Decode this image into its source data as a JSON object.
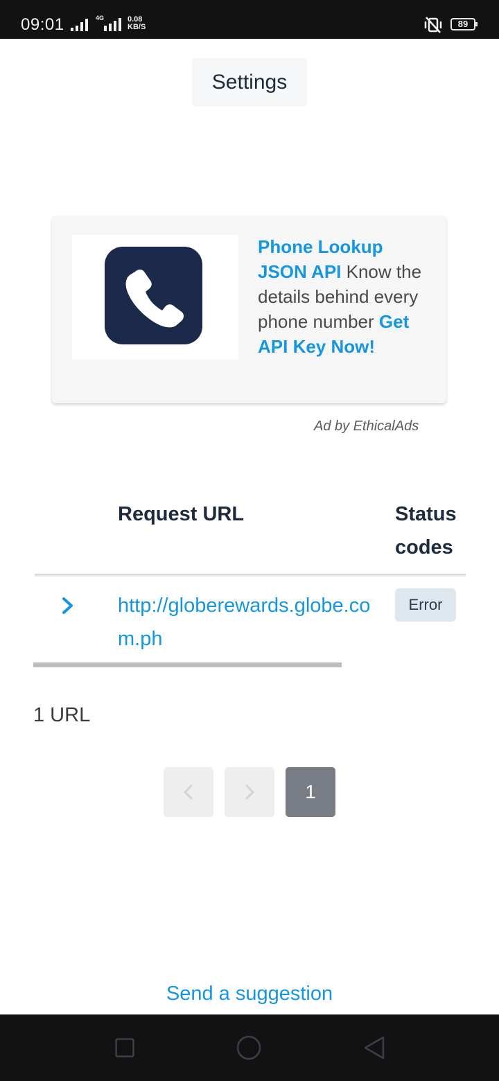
{
  "status_bar": {
    "time": "09:01",
    "network_type": "4G",
    "data_speed_value": "0.08",
    "data_speed_unit": "KB/S",
    "battery": "89",
    "icons": [
      "signal-icon",
      "signal-4g-icon",
      "mute-vibrate-icon",
      "battery-icon"
    ]
  },
  "header": {
    "settings_label": "Settings"
  },
  "ad": {
    "icon": "phone-icon",
    "headline": "Phone Lookup JSON API",
    "body": " Know the details behind every phone number ",
    "cta": "Get API Key Now!",
    "credit": "Ad by EthicalAds"
  },
  "table": {
    "columns": [
      "Request URL",
      "Status codes"
    ],
    "rows": [
      {
        "url": "http://globerewards.globe.com.ph",
        "status": "Error"
      }
    ]
  },
  "summary": {
    "url_count": "1 URL"
  },
  "pagination": {
    "prev_icon": "chevron-left-icon",
    "next_icon": "chevron-right-icon",
    "current_page": "1"
  },
  "footer": {
    "suggestion_link": "Send a suggestion"
  },
  "nav_bar": {
    "icons": [
      "recent-apps-icon",
      "home-icon",
      "back-icon"
    ]
  },
  "colors": {
    "accent": "#1596e0",
    "text_dark": "#1f2a3c",
    "status_badge_bg": "#dfe7ee",
    "page_active_bg": "#787c84",
    "ad_icon_bg": "#1b2a4a"
  }
}
